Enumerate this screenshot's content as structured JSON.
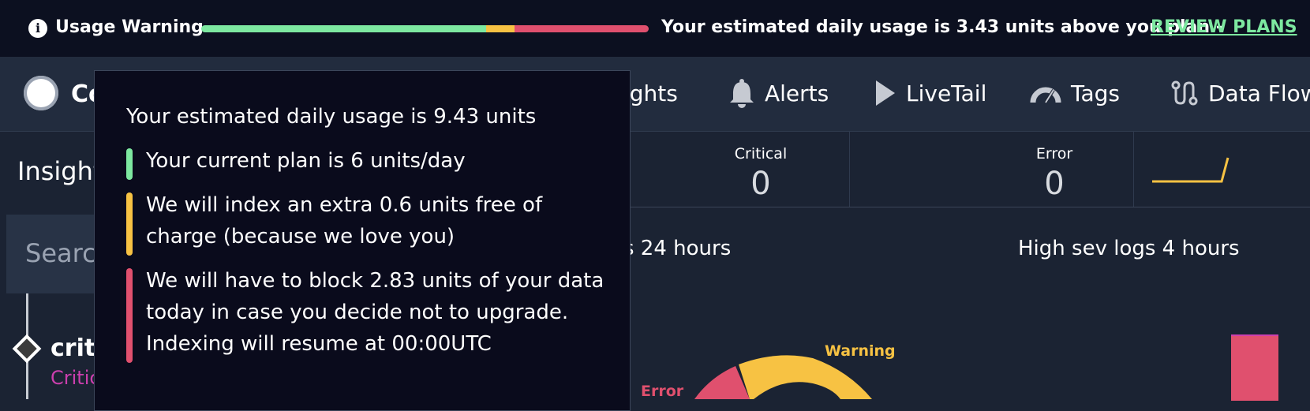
{
  "banner": {
    "info_icon": "info-icon",
    "title": "Usage Warning",
    "bar_segments": [
      {
        "name": "plan",
        "fraction": 0.636,
        "color": "#7de8a0"
      },
      {
        "name": "free-extra",
        "fraction": 0.064,
        "color": "#f7c243"
      },
      {
        "name": "blocked",
        "fraction": 0.3,
        "color": "#e0506e"
      }
    ],
    "message": "Your estimated daily usage is 3.43 units above you plan -",
    "review_link": " REVIEW PLANS"
  },
  "nav": {
    "logo_text": "Co",
    "items": [
      {
        "label": "ights",
        "icon": "insights-icon"
      },
      {
        "label": "Alerts",
        "icon": "bell-icon"
      },
      {
        "label": "LiveTail",
        "icon": "play-icon"
      },
      {
        "label": "Tags",
        "icon": "gauge-icon"
      },
      {
        "label": "Data Flow",
        "icon": "flow-icon"
      }
    ]
  },
  "left_panel": {
    "title": "Insight",
    "search_placeholder": "Searc",
    "timeline_item": {
      "title": "critic",
      "subtitle": "Critic"
    }
  },
  "stats": [
    {
      "label": "Critical",
      "value": "0"
    },
    {
      "label": "Error",
      "value": "0"
    }
  ],
  "sections": {
    "logs_title": "s 24 hours",
    "high_sev_title": "High sev logs 4 hours"
  },
  "chart_data": {
    "type": "pie",
    "labels": [
      "Warning",
      "Error"
    ],
    "colors": {
      "Warning": "#f7c243",
      "Error": "#e0506e"
    }
  },
  "tooltip": {
    "headline": "Your estimated daily usage is 9.43 units",
    "items": [
      {
        "color": "#7de8a0",
        "lines": [
          "Your current plan is 6 units/day"
        ]
      },
      {
        "color": "#f7c243",
        "lines": [
          "We will index an extra 0.6 units free of",
          "charge (because we love you)"
        ]
      },
      {
        "color": "#e0506e",
        "lines": [
          "We will have to block 2.83 units of your data",
          "today in case you decide not to upgrade.",
          "Indexing will resume at 00:00UTC"
        ]
      }
    ]
  }
}
